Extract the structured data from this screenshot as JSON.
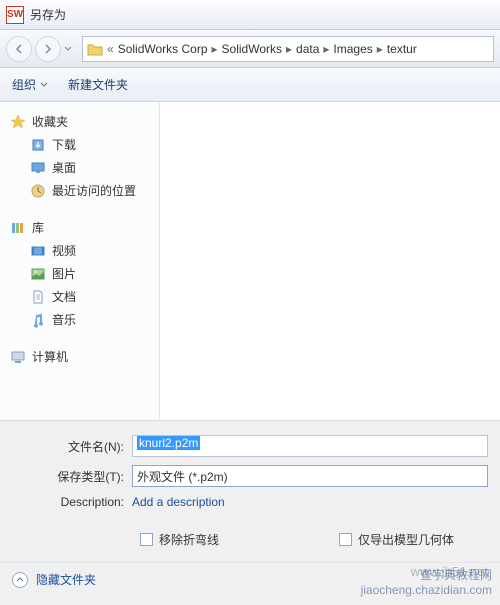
{
  "title": "另存为",
  "breadcrumb": {
    "prefix": "«",
    "items": [
      "SolidWorks Corp",
      "SolidWorks",
      "data",
      "Images",
      "textur"
    ]
  },
  "toolbar": {
    "organize": "组织",
    "new_folder": "新建文件夹"
  },
  "sidebar": {
    "favorites": {
      "label": "收藏夹",
      "items": [
        "下载",
        "桌面",
        "最近访问的位置"
      ]
    },
    "libraries": {
      "label": "库",
      "items": [
        "视频",
        "图片",
        "文档",
        "音乐"
      ]
    },
    "computer": {
      "label": "计算机"
    }
  },
  "form": {
    "filename_label": "文件名(N):",
    "filename_value": "knurl2.p2m",
    "type_label": "保存类型(T):",
    "type_value": "外观文件 (*.p2m)",
    "description_label": "Description:",
    "description_link": "Add a description"
  },
  "checks": {
    "remove_bend": "移除折弯线",
    "export_geom": "仅导出模型几何体"
  },
  "hide_folders": "隐藏文件夹",
  "watermark_main": "查字典教程网",
  "watermark_sub": "jiaocheng.chazidian.com",
  "watermark_bg": "www.jb51.net"
}
